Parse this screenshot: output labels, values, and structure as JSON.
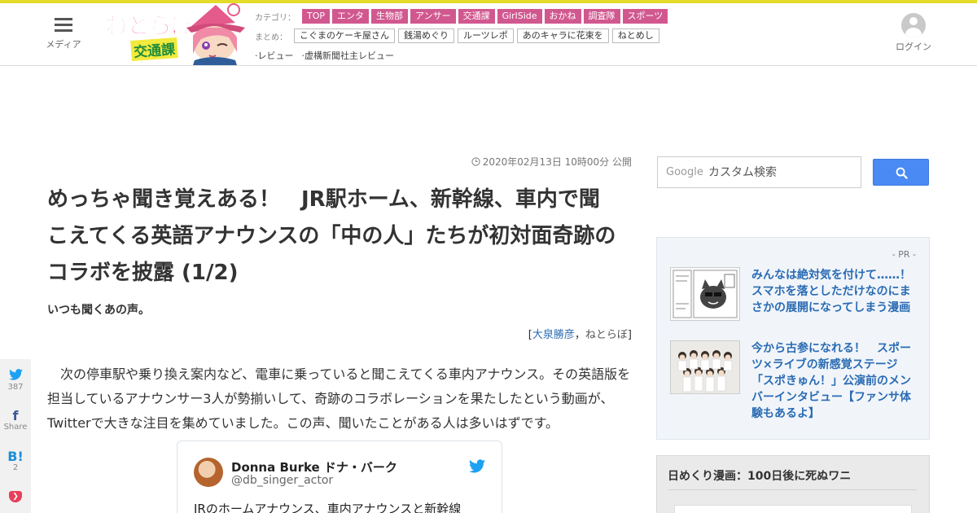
{
  "header": {
    "menu_label": "メディア",
    "logo_text": "ねとらぼ",
    "logo_sub": "交通課",
    "category_label": "カテゴリ：",
    "categories": [
      "TOP",
      "エンタ",
      "生物部",
      "アンサー",
      "交通課",
      "GirlSide",
      "おかね",
      "調査隊",
      "スポーツ"
    ],
    "matome_label": "まとめ：",
    "matome": [
      "こぐまのケーキ屋さん",
      "銭湯めぐり",
      "ルーツレポ",
      "あのキャラに花束を",
      "ねとめし"
    ],
    "reviews": [
      "·レビュー",
      "·虚構新聞社主レビュー"
    ],
    "login_label": "ログイン",
    "accent_color": "#d1588f"
  },
  "article": {
    "date": "2020年02月13日 10時00分 公開",
    "title": "めっちゃ聞き覚えある！　JR駅ホーム、新幹線、車内で聞こえてくる英語アナウンスの「中の人」たちが初対面奇跡のコラボを披露 (1/2)",
    "subtitle": "いつも聞くあの声。",
    "author_open": "[",
    "author_name": "大泉勝彦",
    "author_sep": "，",
    "author_site": "ねとらぼ",
    "author_close": "]",
    "body": "次の停車駅や乗り換え案内など、電車に乗っていると聞こえてくる車内アナウンス。その英語版を担当しているアナウンサー3人が勢揃いして、奇跡のコラボレーションを果たしたという動画が、Twitterで大きな注目を集めていました。この声、聞いたことがある人は多いはずです。"
  },
  "tweet": {
    "name": "Donna Burke ドナ・バーク",
    "handle": "@db_singer_actor",
    "text": "JRのホームアナウンス、車内アナウンスと新幹線"
  },
  "share": {
    "twitter_count": "387",
    "facebook_label": "Share",
    "hatena_label": "B!",
    "hatena_count": "2"
  },
  "search": {
    "google_label": "Google",
    "placeholder": "カスタム検索"
  },
  "pr": {
    "label": "- PR -",
    "items": [
      {
        "text": "みんなは絶対気を付けて……！　スマホを落としただけなのにまさかの展開になってしまう漫画"
      },
      {
        "text": "今から古参になれる！　スポーツ×ライブの新感覚ステージ「スポきゅん！」公演前のメンバーインタビュー【ファンサ体験もあるよ】"
      }
    ]
  },
  "daily": {
    "title": "日めくり漫画：100日後に死ぬワニ"
  }
}
